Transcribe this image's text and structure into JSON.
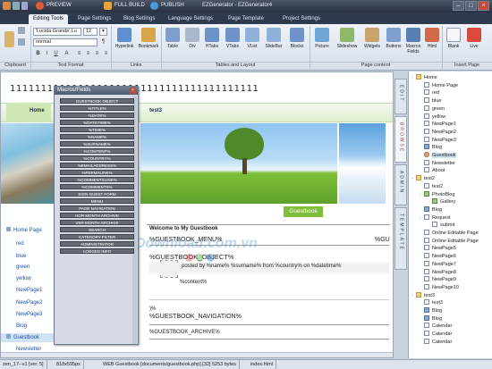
{
  "titlebar": {
    "preview": "PREVIEW",
    "full_build": "FULL BUILD",
    "publish": "PUBLISH",
    "app_title": "EZGenerator - EZGenerator4"
  },
  "tabs": [
    "Editing Tools",
    "Page Settings",
    "Blog Settings",
    "Language Settings",
    "Page Template",
    "Project Settings"
  ],
  "ribbon": {
    "font_name": "'Lucida Grande',Lu",
    "font_size": "12",
    "paragraph_style": "normal",
    "buttons": [
      "Hyperlink",
      "Bookmark",
      "Table",
      "Div",
      "HTabs",
      "VTabs",
      "VList",
      "SlideBar",
      "Blocks",
      "Picture",
      "Slideshow",
      "Widgets",
      "Buttons",
      "Macros Fields",
      "Html",
      "Blank",
      "Live"
    ],
    "groups": [
      "Clipboard",
      "Text Format",
      "Links",
      "Tables and Layout",
      "Page content",
      "Insert Page"
    ]
  },
  "editor": {
    "header_text": "1111111111111111111111111111111111111111",
    "nav_home": "Home",
    "nav_test3": "test3",
    "sidebar_links": [
      "Home Page",
      "red",
      "blue",
      "green",
      "yellow",
      "NewPage1",
      "NewPage2",
      "NewPage3",
      "Blog",
      "Guestbook",
      "Newsletter"
    ],
    "guestbook_badge": "Guestbook",
    "welcome": "Welcome to My Guestbook",
    "menu_macro": "%GUESTBOOK_MENU%",
    "object_macro": "%GUESTBOOK_OBJECT%",
    "right_fragment": "%GU",
    "posted_by": "posted by %name% %surname% from %country% on %datetime%",
    "content_macro": "%content%",
    "paren_fragment": ")%",
    "navigation_macro": "%GUESTBOOK_NAVIGATION%",
    "archive_macro": "%GUESTBOOK_ARCHIVE%",
    "watermark": "Download.com.vn"
  },
  "vertical_tabs": [
    "EDIT",
    "BROWSE",
    "ADMIN",
    "TEMPLATE"
  ],
  "macros_panel": {
    "title": "Macros/Fields",
    "items": [
      "GUESTBOOK OBJECT",
      "%TITLE%",
      "%DATE%",
      "%DATETIME%",
      "%TIME%",
      "%NAME%",
      "%SURNAME%",
      "%CONTENT%",
      "%COUNTRY%",
      "%EMAILADDRESS%",
      "%PERMALINK%",
      "%COMMENTSLINK%",
      "%COMMENTS%",
      "SIGN GUEST FORM",
      "MENU",
      "PAGE NAVIGATION",
      "HOR MONTH ARCHIVE",
      "VER MONTH ARCHIVE",
      "SEARCH",
      "CATEGORY FILTER",
      "ADMINISTRATOR",
      "LOGGED INFO"
    ]
  },
  "tree": {
    "items": [
      {
        "label": "Home",
        "icon": "folder",
        "toggle": "-",
        "indent": 0
      },
      {
        "label": "Home Page",
        "icon": "page",
        "toggle": "",
        "indent": 1
      },
      {
        "label": "red",
        "icon": "page",
        "toggle": "",
        "indent": 1
      },
      {
        "label": "blue",
        "icon": "page",
        "toggle": "",
        "indent": 1
      },
      {
        "label": "green",
        "icon": "page",
        "toggle": "",
        "indent": 1
      },
      {
        "label": "yellow",
        "icon": "page",
        "toggle": "",
        "indent": 1
      },
      {
        "label": "NewPage1",
        "icon": "page",
        "toggle": "",
        "indent": 1
      },
      {
        "label": "NewPage2",
        "icon": "page",
        "toggle": "",
        "indent": 1
      },
      {
        "label": "NewPage3",
        "icon": "page",
        "toggle": "",
        "indent": 1
      },
      {
        "label": "Blog",
        "icon": "book",
        "toggle": "",
        "indent": 1
      },
      {
        "label": "Guestbook",
        "icon": "user",
        "toggle": "",
        "indent": 1
      },
      {
        "label": "Newsletter",
        "icon": "page",
        "toggle": "",
        "indent": 1
      },
      {
        "label": "About",
        "icon": "page",
        "toggle": "",
        "indent": 1
      },
      {
        "label": "test2",
        "icon": "folder",
        "toggle": "-",
        "indent": 0
      },
      {
        "label": "test2",
        "icon": "page",
        "toggle": "",
        "indent": 1
      },
      {
        "label": "PhotoBlog",
        "icon": "pic",
        "toggle": "-",
        "indent": 1
      },
      {
        "label": "Gallery",
        "icon": "pic",
        "toggle": "",
        "indent": 2
      },
      {
        "label": "Blog",
        "icon": "book",
        "toggle": "",
        "indent": 1
      },
      {
        "label": "Request",
        "icon": "page",
        "toggle": "-",
        "indent": 1
      },
      {
        "label": "submit",
        "icon": "page",
        "toggle": "",
        "indent": 2
      },
      {
        "label": "Online Editable Page",
        "icon": "page",
        "toggle": "",
        "indent": 1
      },
      {
        "label": "Online Editable Page",
        "icon": "page",
        "toggle": "",
        "indent": 1
      },
      {
        "label": "NewPage5",
        "icon": "page",
        "toggle": "",
        "indent": 1
      },
      {
        "label": "NewPage6",
        "icon": "page",
        "toggle": "",
        "indent": 1
      },
      {
        "label": "NewPage7",
        "icon": "page",
        "toggle": "",
        "indent": 1
      },
      {
        "label": "NewPage8",
        "icon": "page",
        "toggle": "",
        "indent": 1
      },
      {
        "label": "NewPage9",
        "icon": "page",
        "toggle": "",
        "indent": 1
      },
      {
        "label": "NewPage10",
        "icon": "page",
        "toggle": "",
        "indent": 1
      },
      {
        "label": "test3",
        "icon": "folder",
        "toggle": "-",
        "indent": 0
      },
      {
        "label": "test3",
        "icon": "page",
        "toggle": "",
        "indent": 1
      },
      {
        "label": "Blog",
        "icon": "book",
        "toggle": "",
        "indent": 1
      },
      {
        "label": "Blog",
        "icon": "book",
        "toggle": "",
        "indent": 1
      },
      {
        "label": "Calendar",
        "icon": "page",
        "toggle": "",
        "indent": 1
      },
      {
        "label": "Calendar",
        "icon": "page",
        "toggle": "",
        "indent": 1
      },
      {
        "label": "Calendar",
        "icon": "page",
        "toggle": "",
        "indent": 1
      }
    ]
  },
  "statusbar": {
    "template": "zen_17--v1 [ver. 5]",
    "dims": "818x595px",
    "page": "WEB Guestbook [documents/guestbook.php] [32] 5253 bytes",
    "file": "index.html"
  },
  "colors": {
    "accent_green": "#7fbf3a",
    "link_blue": "#1f4fa0",
    "chrome_dark": "#2e3a4e"
  }
}
